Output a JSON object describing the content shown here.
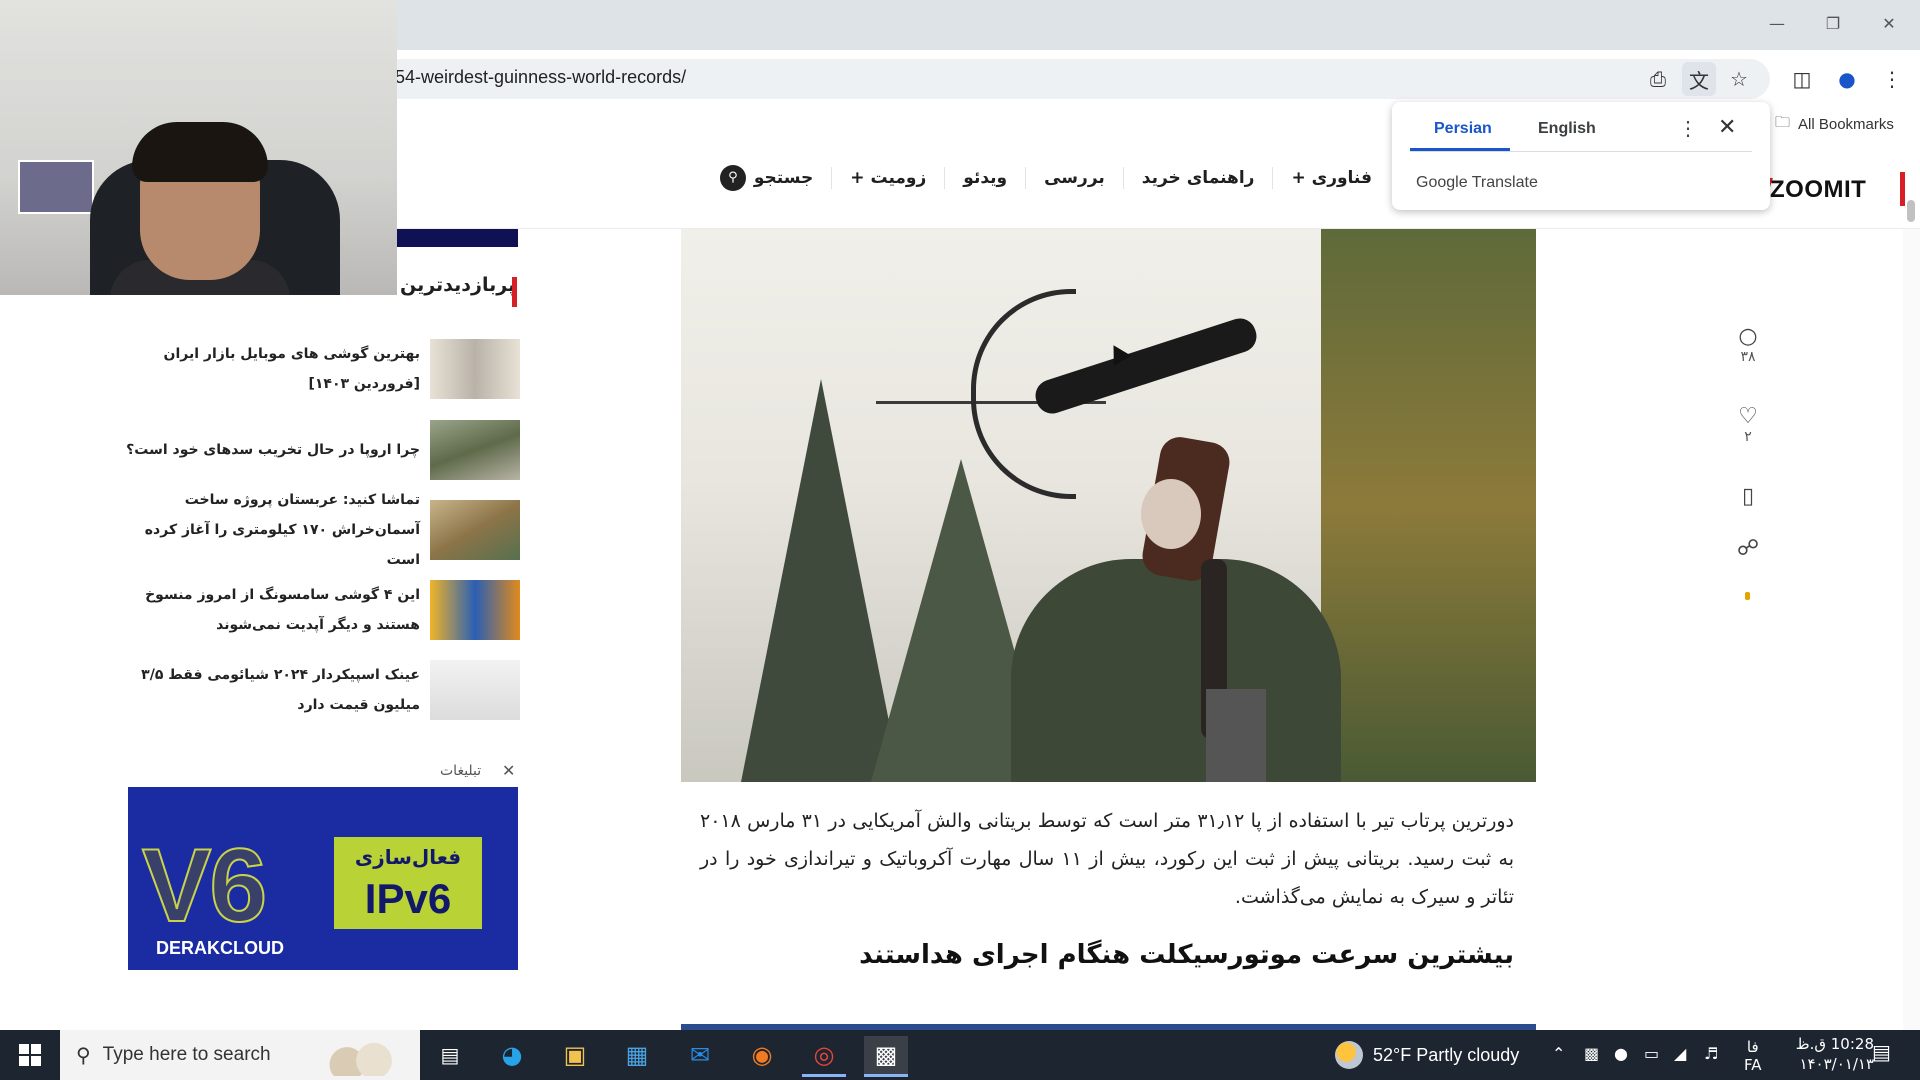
{
  "browser": {
    "url": "54-weirdest-guinness-world-records/",
    "all_bookmarks": "All Bookmarks"
  },
  "translate": {
    "tab_source": "Persian",
    "tab_target": "English",
    "brand": "Google Translate"
  },
  "site": {
    "logo": "ZOOMIT",
    "nav": [
      "+ فناوری",
      "راهنمای خرید",
      "بررسی",
      "ویدئو",
      "+ زومیت"
    ],
    "search_label": "جستجو"
  },
  "sidebar": {
    "title": "پربازدیدترین",
    "items": [
      {
        "text": "بهترین گوشی های موبایل بازار ایران [فروردین ۱۴۰۳]",
        "thumb": "#cfc8bd"
      },
      {
        "text": "چرا اروپا در حال تخریب سدهای خود است؟",
        "thumb": "#6f7d58"
      },
      {
        "text": "تماشا کنید: عربستان پروژه ساخت آسمان‌خراش ۱۷۰ کیلومتری را آغاز کرده است",
        "thumb": "#a88d62"
      },
      {
        "text": "این ۴ گوشی سامسونگ از امروز منسوخ هستند و دیگر آپدیت نمی‌شوند",
        "thumb": "#3a5fae"
      },
      {
        "text": "عینک اسپیکردار ۲۰۲۴ شیائومی فقط ۳/۵ میلیون قیمت دارد",
        "thumb": "#e7e7e7"
      }
    ],
    "ads_label": "تبلیغات"
  },
  "ad": {
    "big_text": "V6",
    "fa_text": "فعال‌سازی",
    "ipv6": "IPv6",
    "brand": "DERAKCLOUD"
  },
  "article": {
    "paragraph": "دورترین پرتاب تیر با استفاده از پا ۳۱٫۱۲ متر است که توسط بریتانی والش آمریکایی در ۳۱ مارس ۲۰۱۸ به ثبت رسید. بریتانی پیش از ثبت این رکورد، بیش از ۱۱ سال مهارت آکروباتیک و تیراندازی خود را در تئاتر و سیرک به نمایش می‌گذاشت.",
    "subheading": "بیشترین سرعت موتورسیکلت هنگام اجرای هداستند"
  },
  "actions": {
    "comments": "۳۸",
    "likes": "۲"
  },
  "taskbar": {
    "search_placeholder": "Type here to search",
    "weather": "52°F  Partly cloudy",
    "lang_line1": "فا",
    "lang_line2": "FA",
    "time": "10:28 ق.ظ",
    "date": "۱۴۰۳/۰۱/۱۳"
  }
}
